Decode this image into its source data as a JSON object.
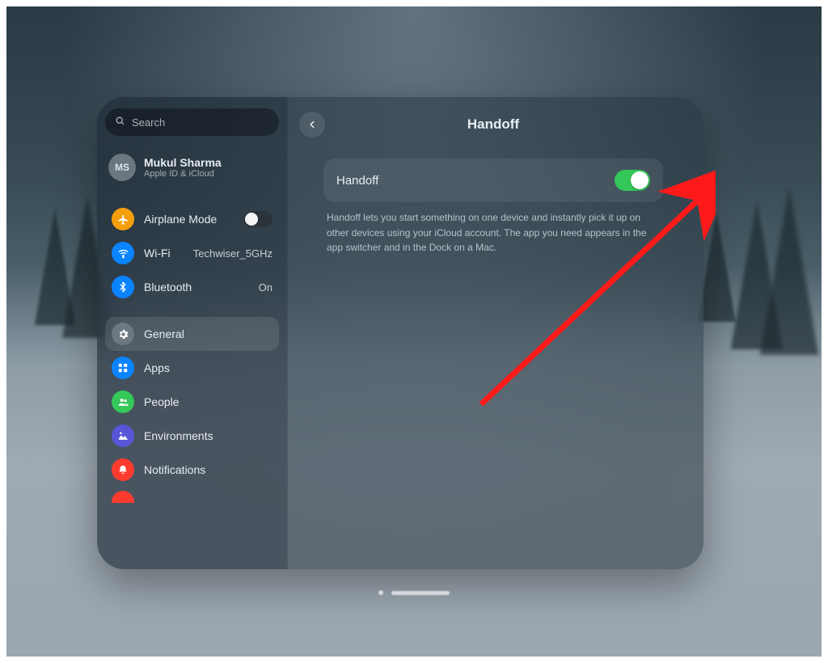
{
  "search": {
    "placeholder": "Search"
  },
  "account": {
    "initials": "MS",
    "name": "Mukul Sharma",
    "subtitle": "Apple ID & iCloud"
  },
  "sidebar": {
    "airplane": {
      "label": "Airplane Mode",
      "enabled": false
    },
    "wifi": {
      "label": "Wi-Fi",
      "value": "Techwiser_5GHz"
    },
    "bluetooth": {
      "label": "Bluetooth",
      "value": "On"
    },
    "general": {
      "label": "General"
    },
    "apps": {
      "label": "Apps"
    },
    "people": {
      "label": "People"
    },
    "environments": {
      "label": "Environments"
    },
    "notifications": {
      "label": "Notifications"
    }
  },
  "page": {
    "title": "Handoff",
    "toggle_label": "Handoff",
    "toggle_on": true,
    "description": "Handoff lets you start something on one device and instantly pick it up on other devices using your iCloud account. The app you need appears in the app switcher and in the Dock on a Mac."
  },
  "colors": {
    "accent_green": "#35c759",
    "arrow": "#ff1a1a"
  }
}
